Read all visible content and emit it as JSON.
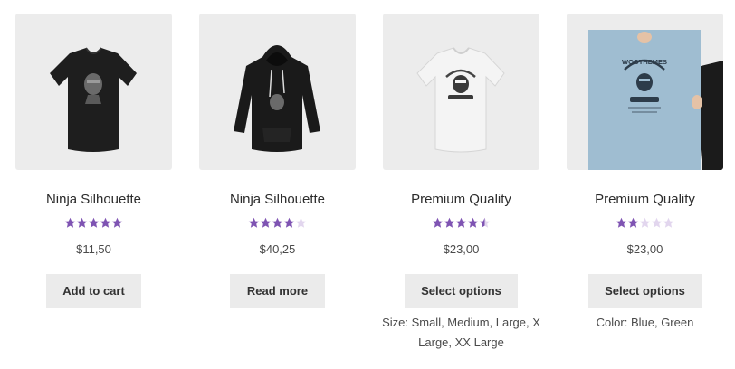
{
  "products": [
    {
      "title": "Ninja Silhouette",
      "rating": 5,
      "price": "$11,50",
      "button": "Add to cart",
      "meta": "",
      "image_icon": "tshirt-black-icon"
    },
    {
      "title": "Ninja Silhouette",
      "rating": 4,
      "price": "$40,25",
      "button": "Read more",
      "meta": "",
      "image_icon": "hoodie-black-icon"
    },
    {
      "title": "Premium Quality",
      "rating": 4.5,
      "price": "$23,00",
      "button": "Select options",
      "meta": "Size: Small, Medium, Large, X Large, XX Large",
      "image_icon": "tshirt-white-icon"
    },
    {
      "title": "Premium Quality",
      "rating": 2,
      "price": "$23,00",
      "button": "Select options",
      "meta": "Color: Blue, Green",
      "image_icon": "poster-icon",
      "logo_text": "WOOTHEMES"
    }
  ],
  "colors": {
    "star_filled": "#7f54b3",
    "star_empty": "#e2d6ee",
    "thumb_bg": "#ececec",
    "button_bg": "#ebebeb"
  }
}
